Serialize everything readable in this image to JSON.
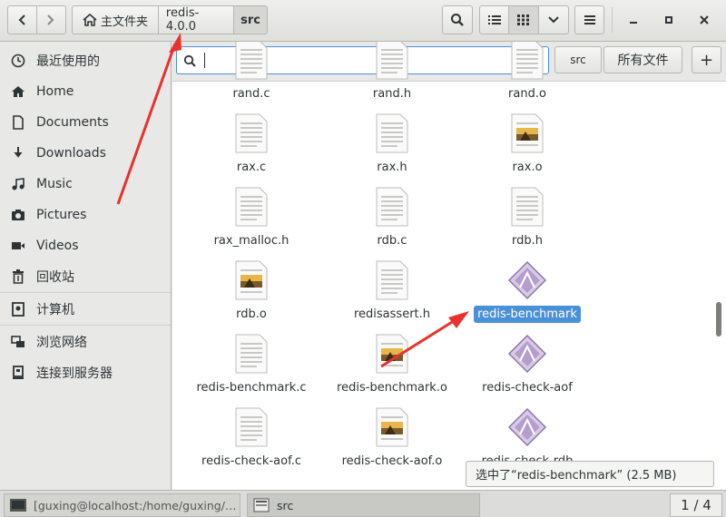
{
  "header": {
    "breadcrumbs": [
      "主文件夹",
      "redis-4.0.0",
      "src"
    ],
    "window_controls": [
      "minimize",
      "maximize",
      "close"
    ]
  },
  "sidebar": {
    "items": [
      {
        "label": "最近使用的",
        "icon": "clock-icon"
      },
      {
        "label": "Home",
        "icon": "home-icon"
      },
      {
        "label": "Documents",
        "icon": "document-icon"
      },
      {
        "label": "Downloads",
        "icon": "download-icon"
      },
      {
        "label": "Music",
        "icon": "music-icon"
      },
      {
        "label": "Pictures",
        "icon": "camera-icon"
      },
      {
        "label": "Videos",
        "icon": "video-icon"
      },
      {
        "label": "回收站",
        "icon": "trash-icon"
      },
      {
        "label": "计算机",
        "icon": "computer-icon"
      },
      {
        "label": "浏览网络",
        "icon": "network-icon"
      },
      {
        "label": "连接到服务器",
        "icon": "server-icon"
      }
    ]
  },
  "search": {
    "value": "",
    "scope_current": "src",
    "scope_all": "所有文件",
    "add_label": "+"
  },
  "files": [
    {
      "name": "rand.c",
      "kind": "text"
    },
    {
      "name": "rand.h",
      "kind": "text"
    },
    {
      "name": "rand.o",
      "kind": "text"
    },
    {
      "name": "rax.c",
      "kind": "text"
    },
    {
      "name": "rax.h",
      "kind": "text"
    },
    {
      "name": "rax.o",
      "kind": "object"
    },
    {
      "name": "rax_malloc.h",
      "kind": "text"
    },
    {
      "name": "rdb.c",
      "kind": "text"
    },
    {
      "name": "rdb.h",
      "kind": "text"
    },
    {
      "name": "rdb.o",
      "kind": "object"
    },
    {
      "name": "redisassert.h",
      "kind": "text"
    },
    {
      "name": "redis-benchmark",
      "kind": "executable",
      "selected": true
    },
    {
      "name": "redis-benchmark.c",
      "kind": "text"
    },
    {
      "name": "redis-benchmark.o",
      "kind": "object"
    },
    {
      "name": "redis-check-aof",
      "kind": "executable"
    },
    {
      "name": "redis-check-aof.c",
      "kind": "text"
    },
    {
      "name": "redis-check-aof.o",
      "kind": "object"
    },
    {
      "name": "redis-check-rdb",
      "kind": "executable"
    }
  ],
  "status": {
    "text": "选中了“redis-benchmark” (2.5 MB)"
  },
  "taskbar": {
    "terminal_label": "[guxing@localhost:/home/guxing/…",
    "files_label": "src",
    "workspace": "1 / 4"
  },
  "colors": {
    "selection": "#4a90d9",
    "annotation_arrow": "#e8322f"
  }
}
